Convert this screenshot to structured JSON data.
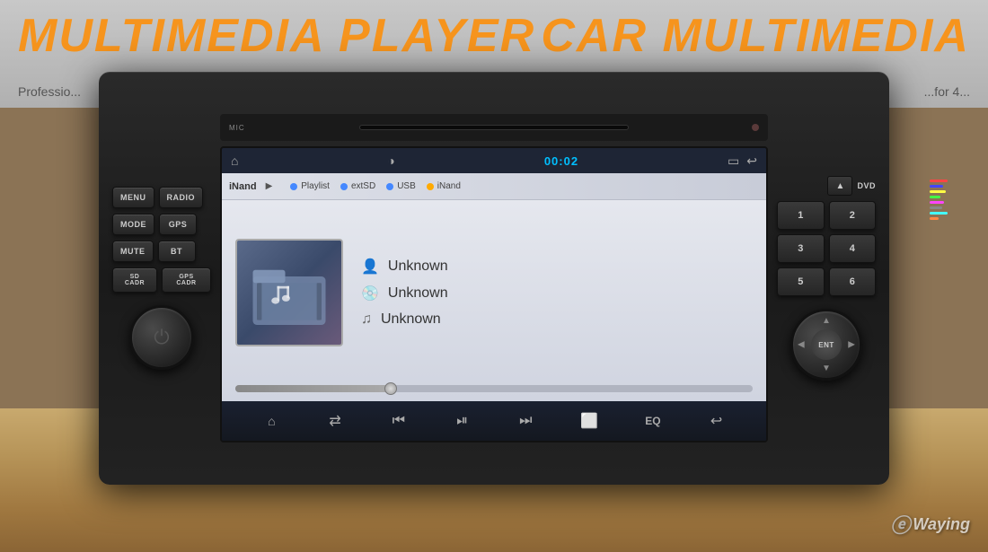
{
  "background": {
    "top_text_left": "MULTIMEDIA PLAYER",
    "top_text_right": "CAR MULTIMEDIA",
    "sub_left": "Professio...",
    "sub_right": "...for 4..."
  },
  "unit": {
    "left_buttons": [
      {
        "row": [
          {
            "label": "MENU"
          },
          {
            "label": "RADIO"
          }
        ]
      },
      {
        "row": [
          {
            "label": "MODE"
          },
          {
            "label": "GPS"
          }
        ]
      },
      {
        "row": [
          {
            "label": "MUTE"
          },
          {
            "label": "BT"
          }
        ]
      },
      {
        "row": [
          {
            "label": "SD CADR"
          },
          {
            "label": "GPS CADR"
          }
        ]
      }
    ],
    "right_buttons": {
      "dvd_label": "DVD",
      "numbers": [
        "1",
        "2",
        "3",
        "4",
        "5",
        "6"
      ]
    },
    "nav_center": "ENT"
  },
  "screen": {
    "status_bar": {
      "home_icon": "⌂",
      "brightness_icon": "◑",
      "time": "00:02",
      "battery_icon": "🔋",
      "back_icon": "↩"
    },
    "source_bar": {
      "current_source": "iNand",
      "tabs": [
        {
          "label": "Playlist",
          "color": "blue"
        },
        {
          "label": "extSD",
          "color": "blue"
        },
        {
          "label": "USB",
          "color": "blue"
        },
        {
          "label": "iNand",
          "color": "yellow"
        }
      ]
    },
    "track_info": {
      "artist": "Unknown",
      "album": "Unknown",
      "title": "Unknown"
    },
    "progress": {
      "percent": 30
    },
    "controls": [
      {
        "icon": "⌂",
        "type": "home"
      },
      {
        "icon": "⇄",
        "type": "shuffle"
      },
      {
        "icon": "⏮",
        "type": "prev"
      },
      {
        "icon": "⏯",
        "type": "playpause"
      },
      {
        "icon": "⏭",
        "type": "next"
      },
      {
        "icon": "⬜",
        "type": "repeat",
        "color": "red"
      },
      {
        "icon": "EQ",
        "type": "eq"
      },
      {
        "icon": "↩",
        "type": "back"
      }
    ]
  },
  "watermark": {
    "logo": "e",
    "name": "Waying"
  }
}
